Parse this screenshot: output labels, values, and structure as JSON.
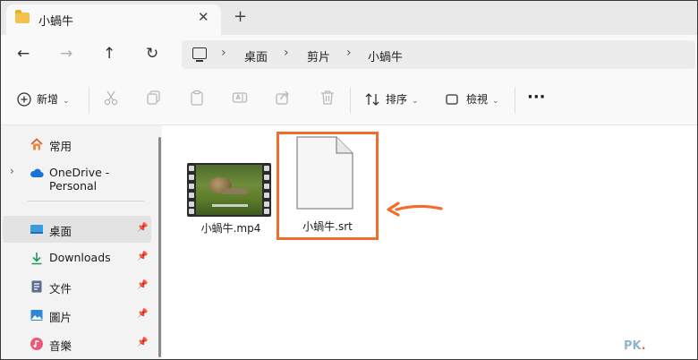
{
  "tab": {
    "title": "小蝸牛",
    "close": "✕",
    "new_tab": "+"
  },
  "nav": {
    "back": "←",
    "forward": "→",
    "up": "↑",
    "refresh": "↻"
  },
  "breadcrumb": [
    "桌面",
    "剪片",
    "小蝸牛"
  ],
  "breadcrumb_separator": "›",
  "toolbar": {
    "new_label": "新增",
    "sort_label": "排序",
    "view_label": "檢視",
    "more": "···",
    "caret": "⌄"
  },
  "sidebar": {
    "items": [
      {
        "label": "常用",
        "icon": "home-icon"
      },
      {
        "label": "OneDrive - Personal",
        "icon": "cloud-icon"
      },
      {
        "label": "桌面",
        "icon": "desktop-icon",
        "selected": true
      },
      {
        "label": "Downloads",
        "icon": "download-icon"
      },
      {
        "label": "文件",
        "icon": "document-icon"
      },
      {
        "label": "圖片",
        "icon": "image-icon"
      },
      {
        "label": "音樂",
        "icon": "music-icon"
      }
    ],
    "pin": "📌",
    "expand": "›"
  },
  "files": [
    {
      "name": "小蝸牛.mp4",
      "type": "video"
    },
    {
      "name": "小蝸牛.srt",
      "type": "document",
      "highlighted": true
    }
  ],
  "watermark": {
    "main": "PK",
    "dot": "."
  },
  "colors": {
    "highlight": "#f26c2d",
    "folder": "#f2c24b",
    "onedrive": "#1a73d9"
  }
}
